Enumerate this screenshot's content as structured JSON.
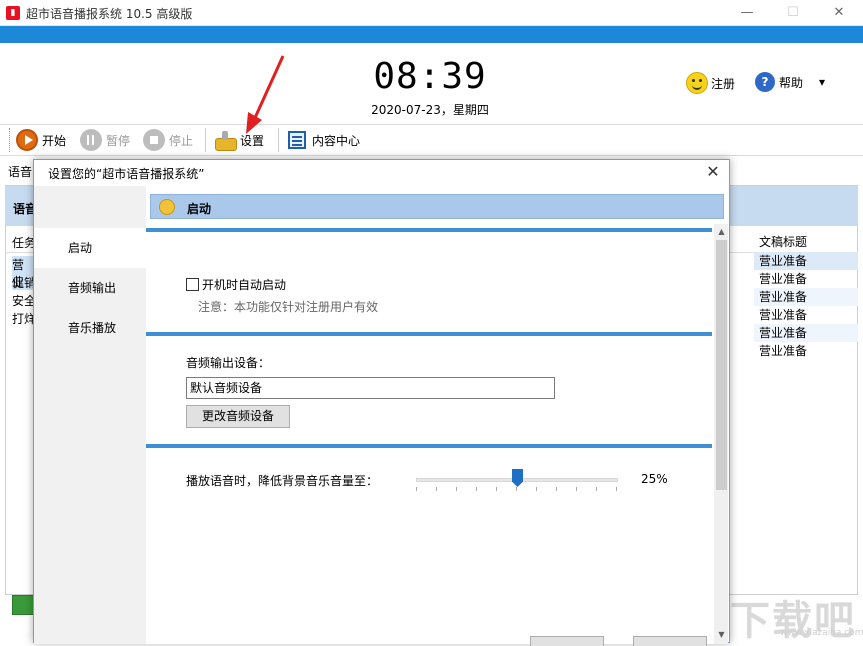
{
  "window": {
    "title": "超市语音播报系统 10.5 高级版",
    "minimize": "—",
    "maximize": "☐",
    "close": "✕"
  },
  "clock": {
    "time": "08:39",
    "date": "2020-07-23，星期四"
  },
  "topright": {
    "register": "注册",
    "help": "帮助",
    "dropdown": "▾"
  },
  "toolbar": {
    "start": "开始",
    "pause": "暂停",
    "stop": "停止",
    "settings": "设置",
    "content_center": "内容中心"
  },
  "background": {
    "label": "语音",
    "panel_title": "语音",
    "col_task": "任务",
    "col_doc_title": "文稿标题",
    "left_items": [
      "营业",
      "促销",
      "安全",
      "打烊"
    ],
    "doc_titles": [
      "营业准备",
      "营业准备",
      "营业准备",
      "营业准备",
      "营业准备",
      "营业准备"
    ],
    "watermark": "下载吧",
    "watermark_sub": "www.xiazaiba.com"
  },
  "dialog": {
    "title": "设置您的“超市语音播报系统”",
    "close": "✕",
    "nav": [
      "启动",
      "音频输出",
      "音乐播放"
    ],
    "section_title": "启动",
    "autostart_label": "开机时自动启动",
    "note": "注意：本功能仅针对注册用户有效",
    "device_label": "音频输出设备：",
    "device_value": "默认音频设备",
    "change_button": "更改音频设备",
    "slider_label": "播放语音时，降低背景音乐音量至：",
    "slider_value": "25%",
    "slider_fraction": 0.5,
    "autostart_checked": false
  },
  "colors": {
    "accent_blue": "#1e88d8",
    "section_bar": "#aac8ea",
    "arrow_red": "#e02020"
  }
}
